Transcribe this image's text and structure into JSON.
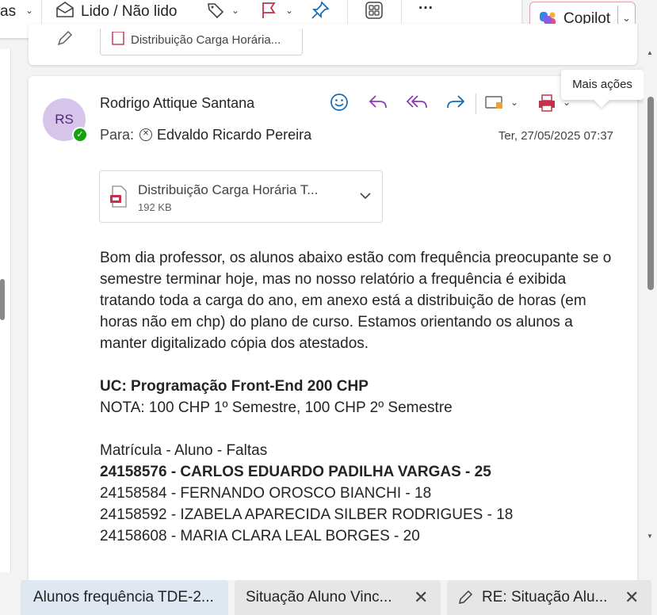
{
  "ribbon": {
    "partial_label": "as",
    "read_unread_label": "Lido / Não lido",
    "more_label": "···",
    "copilot_label": "Copilot"
  },
  "previous_message": {
    "attachment_name": "Distribuição Carga Horária..."
  },
  "message": {
    "avatar_initials": "RS",
    "sender": "Rodrigo Attique Santana",
    "to_label": "Para:",
    "recipient": "Edvaldo Ricardo Pereira",
    "date": "Ter, 27/05/2025 07:37",
    "attachment": {
      "name": "Distribuição Carga Horária T...",
      "size": "192 KB"
    },
    "body": {
      "intro": "Bom dia professor, os alunos abaixo estão com frequência preocupante se o semestre terminar hoje, mas no nosso relatório a frequência é exibida tratando toda a carga do ano, em anexo está a distribuição de horas (em horas não em chp) do plano de curso. Estamos orientando os alunos a manter digitalizado cópia dos atestados.",
      "uc_title": "UC: Programação Front-End 200 CHP",
      "nota": "NOTA: 100 CHP 1º Semestre, 100 CHP 2º Semestre",
      "list_header": "Matrícula - Aluno - Faltas",
      "students": [
        "24158576 - CARLOS EDUARDO PADILHA VARGAS - 25",
        "24158584 - FERNANDO OROSCO BIANCHI - 18",
        "24158592 - IZABELA APARECIDA SILBER RODRIGUES - 18",
        "24158608 - MARIA CLARA LEAL BORGES - 20"
      ]
    }
  },
  "tooltip": "Mais ações",
  "tabs": [
    {
      "label": "Alunos frequência TDE-2..."
    },
    {
      "label": "Situação Aluno Vinc..."
    },
    {
      "label": "RE: Situação Alu..."
    }
  ],
  "colors": {
    "accent": "#0f6cbd",
    "flag": "#c4314b",
    "reply_all": "#8a3ab9",
    "avatar_bg": "#d7c4ea",
    "presence": "#13a10e"
  }
}
